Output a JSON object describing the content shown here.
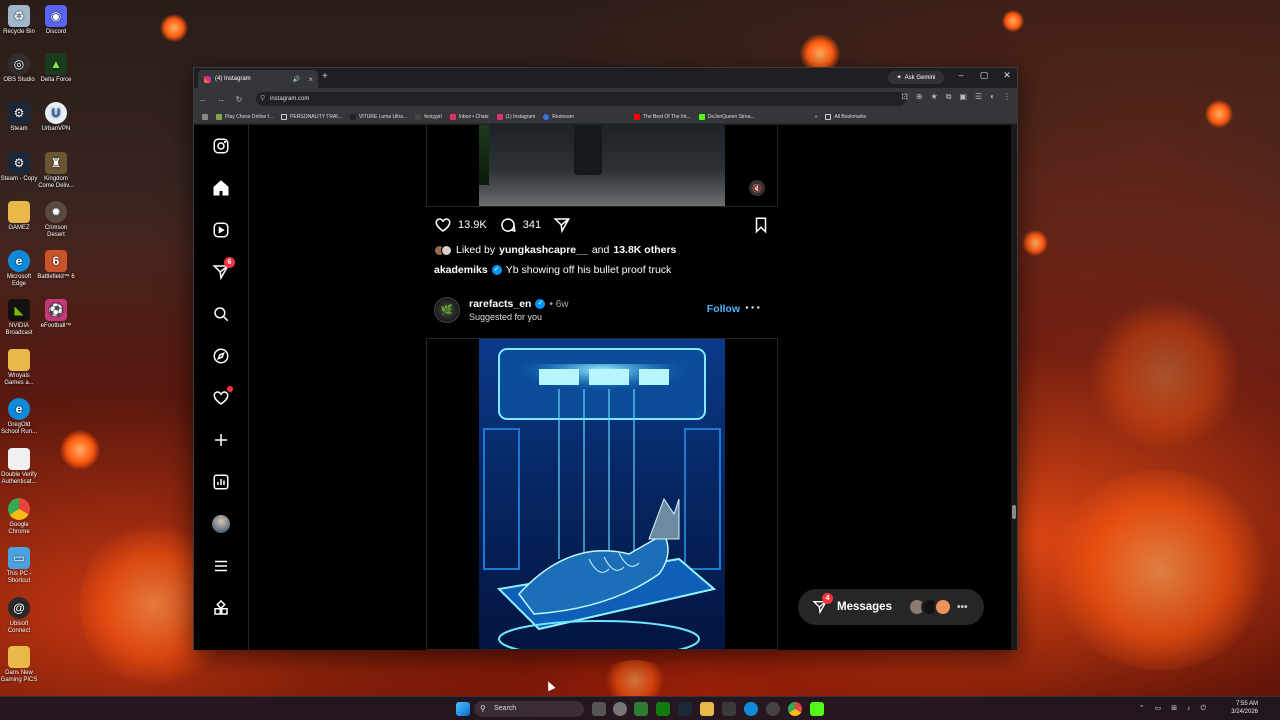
{
  "desktop": {
    "icons": [
      {
        "label": "Recycle Bin",
        "color": "#9fb7c9"
      },
      {
        "label": "Discord",
        "color": "#5865f2"
      },
      {
        "label": "OBS Studio",
        "color": "#302e31"
      },
      {
        "label": "Delta Force",
        "color": "#1b3b1d"
      },
      {
        "label": "Steam",
        "color": "#1b2838"
      },
      {
        "label": "UrbanVPN",
        "color": "#e8eef5"
      },
      {
        "label": "Steam - Copy",
        "color": "#1b2838"
      },
      {
        "label": "Kingdom Come Deliv...",
        "color": "#6b5535"
      },
      {
        "label": "GAMEZ",
        "color": "#e8b84a"
      },
      {
        "label": "Crimson Desert",
        "color": "#5a4a40"
      },
      {
        "label": "Microsoft Edge",
        "color": "#0f8ad9"
      },
      {
        "label": "Battlefield™ 6",
        "color": "#c8542a"
      },
      {
        "label": "NVIDIA Broadcast",
        "color": "#76b900"
      },
      {
        "label": "eFootball™",
        "color": "#c03a7a"
      },
      {
        "label": "Wroyals Games a...",
        "color": "#e8b84a"
      },
      {
        "label": "GregOld School Run...",
        "color": "#0f8ad9"
      },
      {
        "label": "Double Verify Authenticat...",
        "color": "#f0f0f0"
      },
      {
        "label": "Google Chrome",
        "color": "#e8453c"
      },
      {
        "label": "This PC - Shortcut",
        "color": "#4aa3df"
      },
      {
        "label": "Ubisoft Connect",
        "color": "#2a2a2a"
      },
      {
        "label": "Dans New Gaming PICS",
        "color": "#e8b84a"
      }
    ]
  },
  "browser": {
    "tab_title": "(4) Instagram",
    "ask_gemini": "Ask Gemini",
    "url": "instagram.com",
    "bookmarks": [
      "Play Chess Online f...",
      "PERSONALITY TRAI...",
      "VITURE Luma Ultra...",
      "fentygirl",
      "Inbox • Chats",
      "(1) Instagram",
      "Restream",
      "The Best Of The Int...",
      "DeJenQueen Strea...",
      "All Bookmarks"
    ]
  },
  "instagram": {
    "notifications_badge": "6",
    "previous_post": {
      "likes": "13.9K",
      "comments": "341",
      "liked_by_prefix": "Liked by",
      "liked_by_user": "yungkashcapre__",
      "liked_by_and": "and",
      "liked_by_others": "13.8K others",
      "caption_user": "akademiks",
      "caption_text": "Yb showing off his bullet proof truck"
    },
    "next_post": {
      "username": "rarefacts_en",
      "age": "• 6w",
      "subtitle": "Suggested for you",
      "follow_label": "Follow"
    },
    "messages": {
      "label": "Messages",
      "badge": "4"
    }
  },
  "taskbar": {
    "search_placeholder": "Search",
    "time": "7:55 AM",
    "date": "3/24/2026"
  },
  "colors": {
    "instagram_bg": "#000000",
    "accent_blue": "#0095f6",
    "follow_blue": "#4cb5f9",
    "notification_red": "#ff3040"
  }
}
